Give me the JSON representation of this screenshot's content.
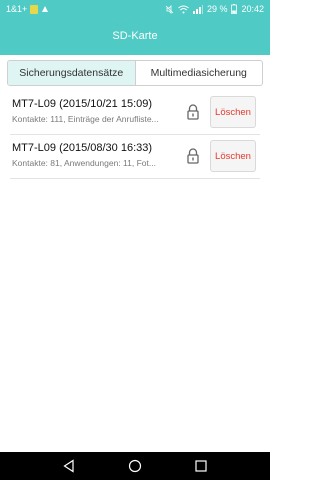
{
  "statusbar": {
    "carrier": "1&1+",
    "battery_percent": "29 %",
    "time": "20:42"
  },
  "header": {
    "title": "SD-Karte"
  },
  "tabs": [
    {
      "label": "Sicherungsdatensätze",
      "active": true
    },
    {
      "label": "Multimediasicherung",
      "active": false
    }
  ],
  "backups": [
    {
      "title": "MT7-L09 (2015/10/21 15:09)",
      "subtitle": "Kontakte: 111, Einträge der Anrufliste...",
      "delete_label": "Löschen"
    },
    {
      "title": "MT7-L09 (2015/08/30 16:33)",
      "subtitle": "Kontakte: 81, Anwendungen: 11, Fot...",
      "delete_label": "Löschen"
    }
  ],
  "colors": {
    "header": "#4fcac5",
    "active_tab": "#dff5f3",
    "delete_text": "#e23b2e"
  }
}
